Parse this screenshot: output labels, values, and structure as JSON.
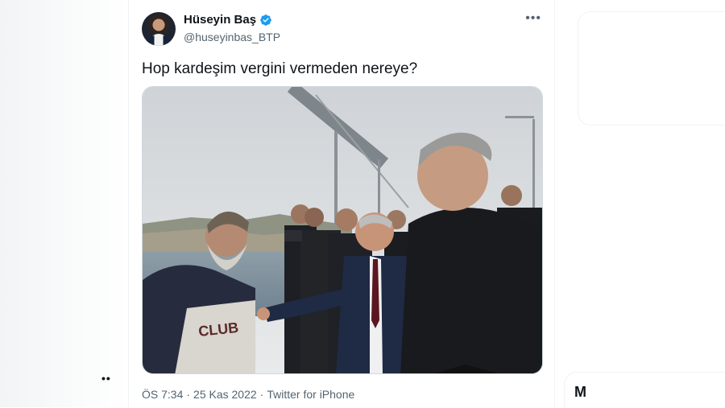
{
  "tweet": {
    "author_name": "Hüseyin Baş",
    "author_handle": "@huseyinbas_BTP",
    "more_label": "•••",
    "text": "Hop kardeşim vergini vermeden nereye?",
    "time": "ÖS 7:34",
    "separator": "·",
    "date": "25 Kas 2022",
    "source": "Twitter for iPhone"
  },
  "left": {
    "dots": "••"
  },
  "sidebar": {
    "partial_letter": "M"
  },
  "colors": {
    "verified": "#1d9bf0",
    "muted": "#536471",
    "text": "#0f1419"
  }
}
